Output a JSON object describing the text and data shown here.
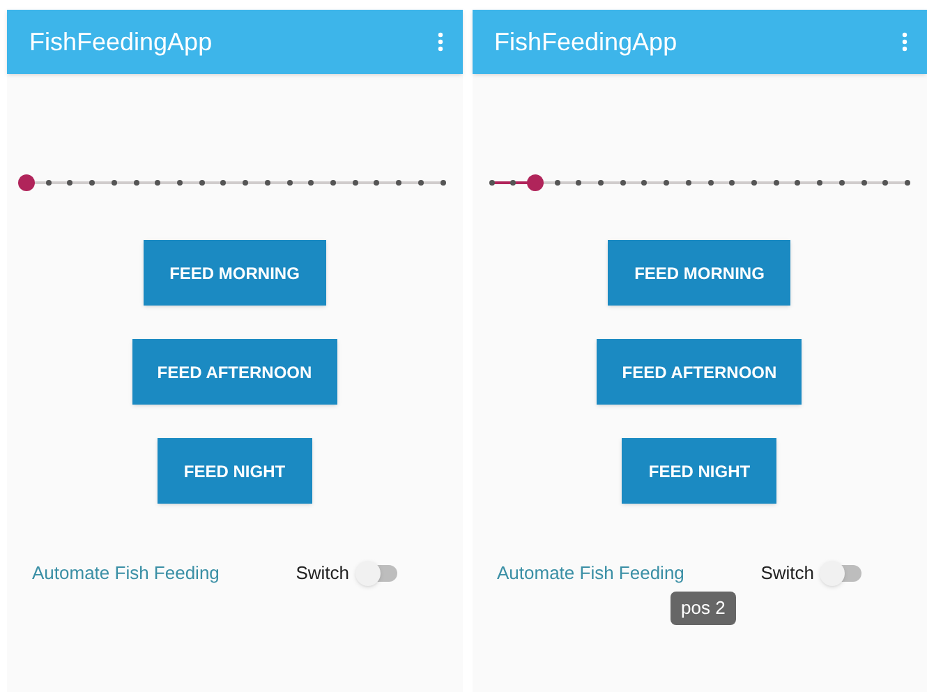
{
  "screens": [
    {
      "title": "FishFeedingApp",
      "slider": {
        "level": 0
      },
      "buttons": [
        "FEED MORNING",
        "FEED AFTERNOON",
        "FEED NIGHT"
      ],
      "automate_label": "Automate Fish Feeding",
      "switch": {
        "label": "Switch",
        "on": false
      }
    },
    {
      "title": "FishFeedingApp",
      "slider": {
        "level": 0.105
      },
      "buttons": [
        "FEED MORNING",
        "FEED AFTERNOON",
        "FEED NIGHT"
      ],
      "automate_label": "Automate Fish Feeding",
      "switch": {
        "label": "Switch",
        "on": false
      },
      "toast": "pos 2"
    }
  ]
}
